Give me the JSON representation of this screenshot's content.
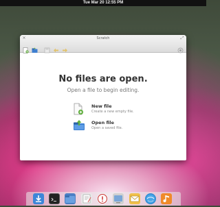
{
  "topbar": {
    "clock": "Tue Mar 20 12:55 PM"
  },
  "window": {
    "title": "Scratch",
    "toolbar": {
      "buttons": [
        "new-document-icon",
        "open-folder-icon",
        "save-icon",
        "undo-icon",
        "redo-icon",
        "settings-icon"
      ]
    },
    "empty_state": {
      "headline": "No files are open.",
      "subtitle": "Open a file to begin editing.",
      "actions": [
        {
          "label": "New file",
          "description": "Create a new empty file."
        },
        {
          "label": "Open file",
          "description": "Open a saved file."
        }
      ]
    }
  },
  "dock": {
    "apps": [
      "download-icon",
      "terminal-icon",
      "files-icon",
      "text-editor-icon",
      "help-icon",
      "settings-icon",
      "mail-icon",
      "browser-icon",
      "music-icon"
    ]
  }
}
